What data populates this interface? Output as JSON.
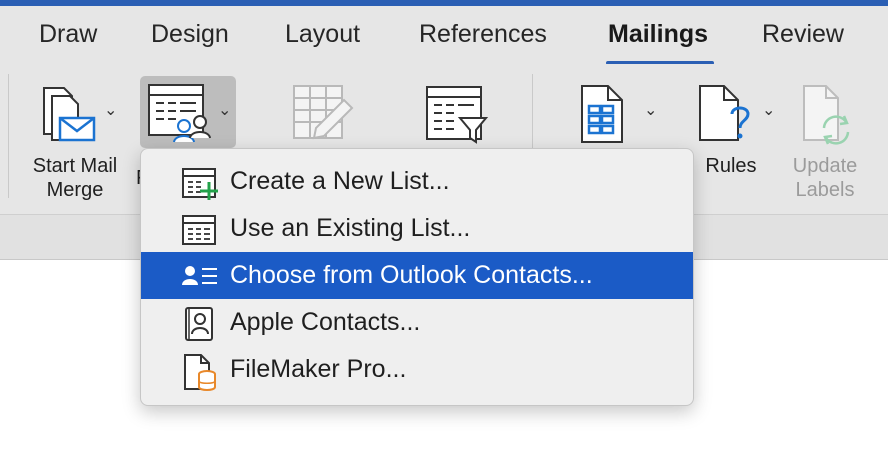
{
  "tabs": {
    "draw": "Draw",
    "design": "Design",
    "layout": "Layout",
    "references": "References",
    "mailings": "Mailings",
    "review": "Review",
    "active": "Mailings"
  },
  "ribbon": {
    "start_mail_merge": {
      "line1": "Start Mail",
      "line2": "Merge"
    },
    "select_recipients_partial": "F",
    "rules": "Rules",
    "update_labels": {
      "line1": "Update",
      "line2": "Labels"
    }
  },
  "menu": {
    "items": [
      {
        "label": "Create a New List...",
        "icon": "new-list-icon"
      },
      {
        "label": "Use an Existing List...",
        "icon": "existing-list-icon"
      },
      {
        "label": "Choose from Outlook Contacts...",
        "icon": "outlook-contacts-icon",
        "selected": true
      },
      {
        "label": "Apple Contacts...",
        "icon": "apple-contacts-icon"
      },
      {
        "label": "FileMaker Pro...",
        "icon": "filemaker-icon"
      }
    ]
  },
  "colors": {
    "accent": "#2b5fb4",
    "selection": "#1b5bc6",
    "ribbon_bg": "#e6e6e6",
    "menu_bg": "#efefef"
  }
}
